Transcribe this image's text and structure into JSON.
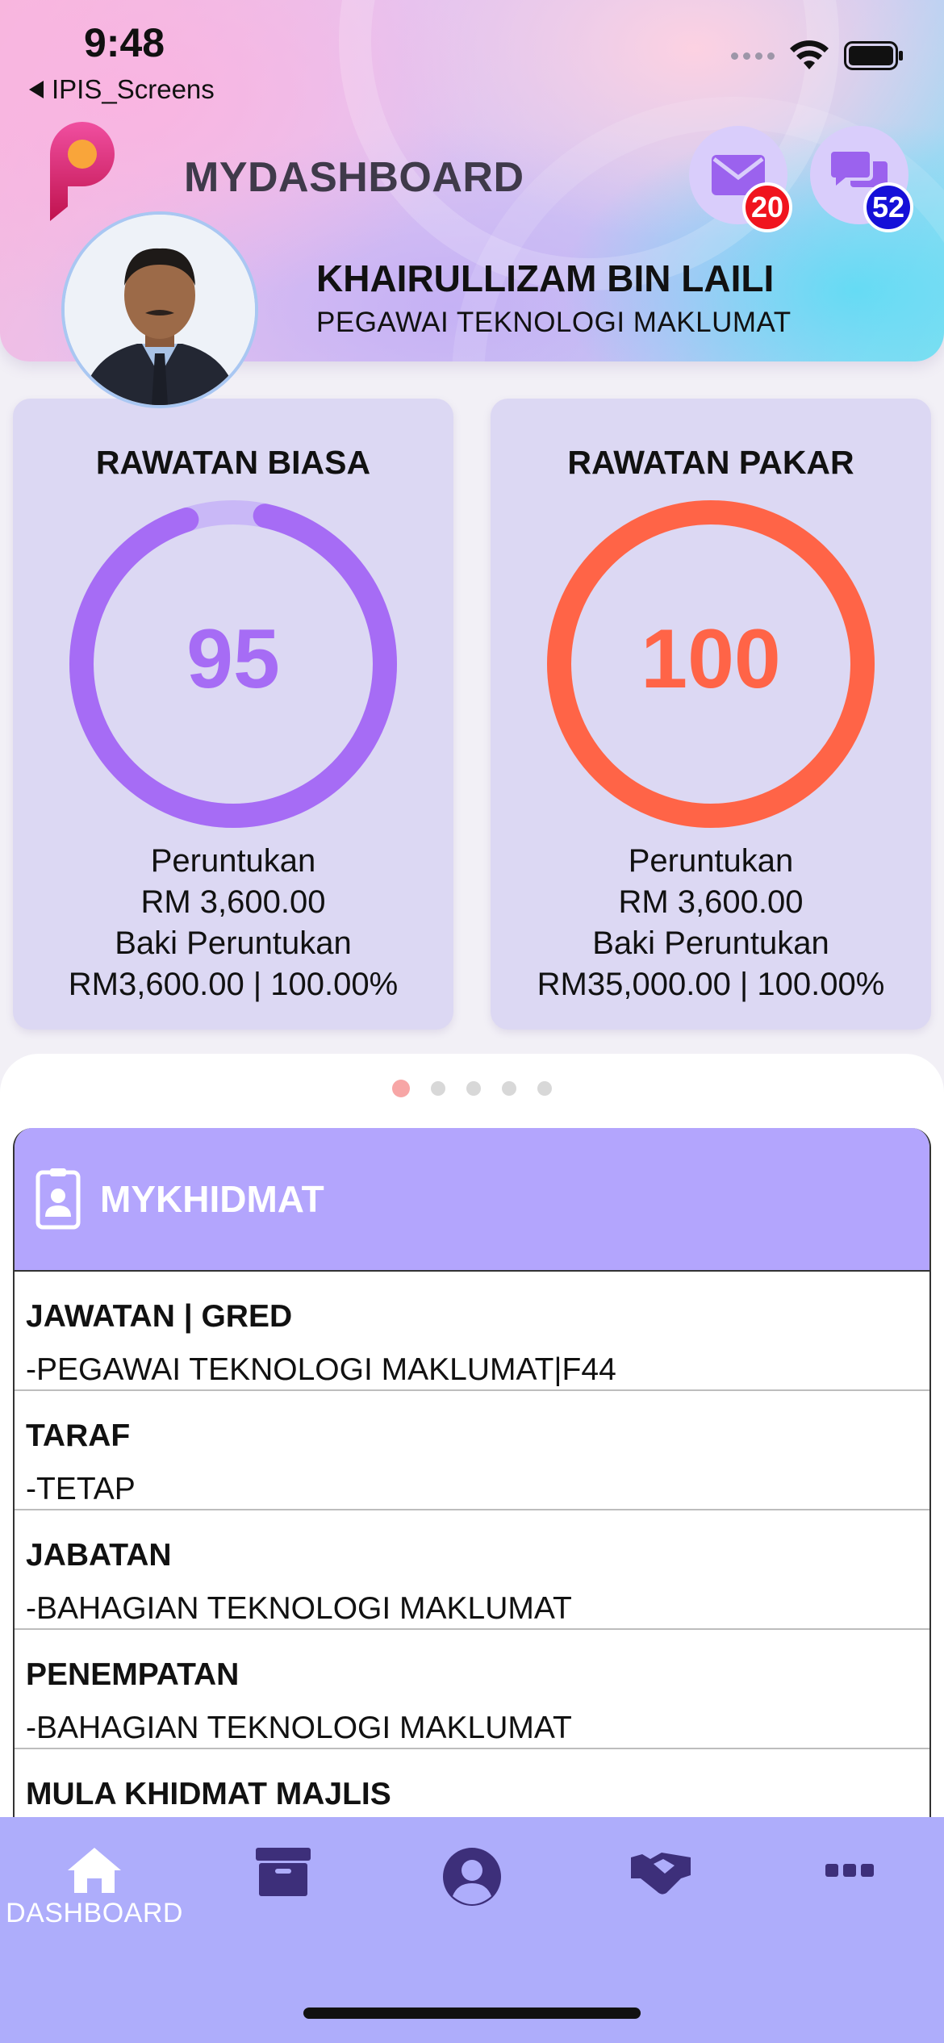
{
  "status_bar": {
    "time": "9:48",
    "back_app": "IPIS_Screens"
  },
  "header": {
    "app_title": "MYDASHBOARD",
    "mail_badge": "20",
    "chat_badge": "52",
    "user_name": "KHAIRULLIZAM BIN LAILI",
    "user_role": "PEGAWAI TEKNOLOGI MAKLUMAT"
  },
  "cards": [
    {
      "title": "RAWATAN BIASA",
      "value": "95",
      "progress_percent": 95,
      "color": "#a66cf5",
      "allocation_label": "Peruntukan",
      "allocation_value": "RM 3,600.00",
      "balance_label": "Baki Peruntukan",
      "balance_value": "RM3,600.00 | 100.00%"
    },
    {
      "title": "RAWATAN PAKAR",
      "value": "100",
      "progress_percent": 100,
      "color": "#ff6447",
      "allocation_label": "Peruntukan",
      "allocation_value": "RM 3,600.00",
      "balance_label": "Baki Peruntukan",
      "balance_value": "RM35,000.00 | 100.00%"
    }
  ],
  "pager": {
    "count": 5,
    "active_index": 0
  },
  "mykhidmat": {
    "title": "MYKHIDMAT",
    "rows": [
      {
        "label": "JAWATAN | GRED",
        "value": "-PEGAWAI TEKNOLOGI MAKLUMAT|F44"
      },
      {
        "label": "TARAF",
        "value": "-TETAP"
      },
      {
        "label": "JABATAN",
        "value": "-BAHAGIAN TEKNOLOGI MAKLUMAT"
      },
      {
        "label": "PENEMPATAN",
        "value": "-BAHAGIAN TEKNOLOGI MAKLUMAT"
      },
      {
        "label": "MULA KHIDMAT MAJLIS",
        "value": ""
      }
    ]
  },
  "tabbar": {
    "items": [
      {
        "icon": "home-icon",
        "label": "DASHBOARD",
        "active": true
      },
      {
        "icon": "archive-icon",
        "label": ""
      },
      {
        "icon": "user-circle-icon",
        "label": ""
      },
      {
        "icon": "handshake-icon",
        "label": ""
      },
      {
        "icon": "more-icon",
        "label": ""
      }
    ]
  },
  "colors": {
    "accent_purple": "#a66cf5",
    "accent_orange": "#ff6447",
    "section_header": "#b3a5fd",
    "tabbar": "#aeadfb",
    "badge_red": "#f0141e",
    "badge_blue": "#1510d8"
  }
}
